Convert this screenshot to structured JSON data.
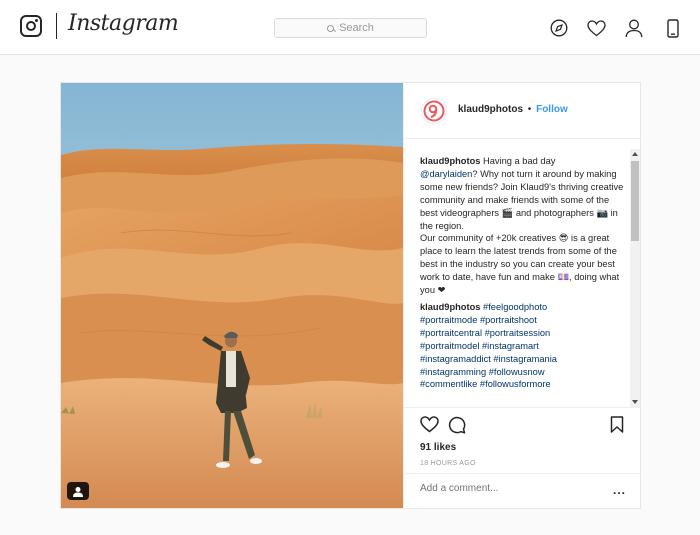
{
  "header": {
    "brand": "Instagram",
    "search_placeholder": "Search",
    "nav_icons": [
      "explore-compass-icon",
      "activity-heart-icon",
      "profile-icon",
      "mobile-app-icon"
    ]
  },
  "post": {
    "username": "klaud9photos",
    "separator": "•",
    "follow_label": "Follow",
    "caption": {
      "username": "klaud9photos",
      "text_part1": "Having a bad day",
      "mention": "@darylaiden",
      "text_part2": "? Why not turn it around by making some new friends? Join Klaud9's thriving creative community and make friends with some of the best videographers 🎬 and photographers 📷 in the region.",
      "text_part3": "Our community of +20k creatives 😎 is a great place to learn the latest trends from some of the best in the industry so you can create your best work to date, have fun and make 💷, doing what you ❤"
    },
    "hashtag_comment": {
      "username": "klaud9photos",
      "tags_line1": "#feelgoodphoto",
      "tags_line2": "#portraitmode #portraitshoot",
      "tags_line3": "#portraitcentral #portraitsession",
      "tags_line4": "#portraitmodel #instagramart",
      "tags_line5": "#instagramaddict #instagramania",
      "tags_line6": "#instagramming #followusnow",
      "tags_line7": "#commentlike #followusformore"
    },
    "likes": "91 likes",
    "timestamp": "18 HOURS AGO",
    "add_comment_placeholder": "Add a comment...",
    "more_label": "..."
  },
  "colors": {
    "accent_link": "#3897f0",
    "brand_avatar": "#e8595f"
  }
}
